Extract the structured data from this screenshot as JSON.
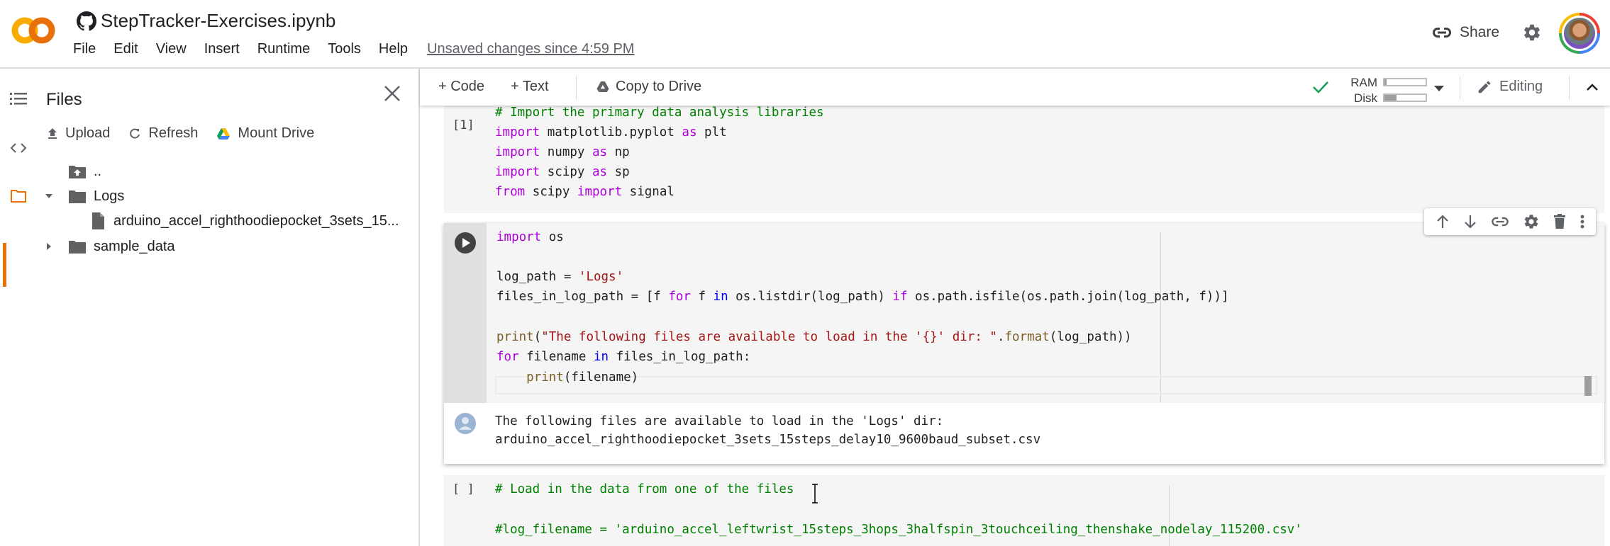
{
  "header": {
    "title": "StepTracker-Exercises.ipynb",
    "menu": [
      "File",
      "Edit",
      "View",
      "Insert",
      "Runtime",
      "Tools",
      "Help"
    ],
    "save_status": "Unsaved changes since 4:59 PM",
    "share_label": "Share",
    "icons": {
      "logo": "colab-logo",
      "source": "github-icon",
      "share": "link-icon",
      "settings": "gear-icon",
      "account": "avatar"
    },
    "colors": {
      "logo_light": "#f9ab00",
      "logo_dark": "#e8710a",
      "active_rail": "#e8710a"
    }
  },
  "rail": {
    "items": [
      {
        "name": "table-of-contents",
        "icon": "list-icon"
      },
      {
        "name": "code-snippets",
        "icon": "code-icon"
      },
      {
        "name": "files",
        "icon": "folder-icon",
        "active": true
      }
    ]
  },
  "sidebar": {
    "title": "Files",
    "actions": [
      {
        "label": "Upload",
        "icon": "upload-icon"
      },
      {
        "label": "Refresh",
        "icon": "refresh-icon"
      },
      {
        "label": "Mount Drive",
        "icon": "drive-icon"
      }
    ],
    "tree": [
      {
        "label": "..",
        "type": "parent-folder"
      },
      {
        "label": "Logs",
        "type": "folder",
        "expanded": true
      },
      {
        "label": "arduino_accel_righthoodiepocket_3sets_15...",
        "type": "file"
      },
      {
        "label": "sample_data",
        "type": "folder",
        "expanded": false
      }
    ]
  },
  "toolbar": {
    "add_code": "+ Code",
    "add_text": "+ Text",
    "copy_to_drive": "Copy to Drive",
    "ram_label": "RAM",
    "disk_label": "Disk",
    "ram_usage": 0.05,
    "disk_usage": 0.3,
    "connected": true,
    "mode": "Editing"
  },
  "cells": {
    "cell1": {
      "exec_count": "[1]",
      "lines": [
        "# Import the primary data analysis libraries",
        "import matplotlib.pyplot as plt",
        "import numpy as np",
        "import scipy as sp",
        "from scipy import signal"
      ]
    },
    "cell2": {
      "lines": [
        "import os",
        "",
        "log_path = 'Logs'",
        "files_in_log_path = [f for f in os.listdir(log_path) if os.path.isfile(os.path.join(log_path, f))]",
        "",
        "print(\"The following files are available to load in the '{}' dir: \".format(log_path))",
        "for filename in files_in_log_path:",
        "    print(filename)"
      ],
      "output": [
        "The following files are available to load in the 'Logs' dir:",
        "arduino_accel_righthoodiepocket_3sets_15steps_delay10_9600baud_subset.csv"
      ],
      "tools": [
        "move-up",
        "move-down",
        "link",
        "settings",
        "delete",
        "more"
      ]
    },
    "cell3": {
      "exec_count": "[ ]",
      "lines": [
        "# Load in the data from one of the files",
        "",
        "#log_filename = 'arduino_accel_leftwrist_15steps_3hops_3halfspin_3touchceiling_thenshake_nodelay_115200.csv'"
      ]
    }
  }
}
